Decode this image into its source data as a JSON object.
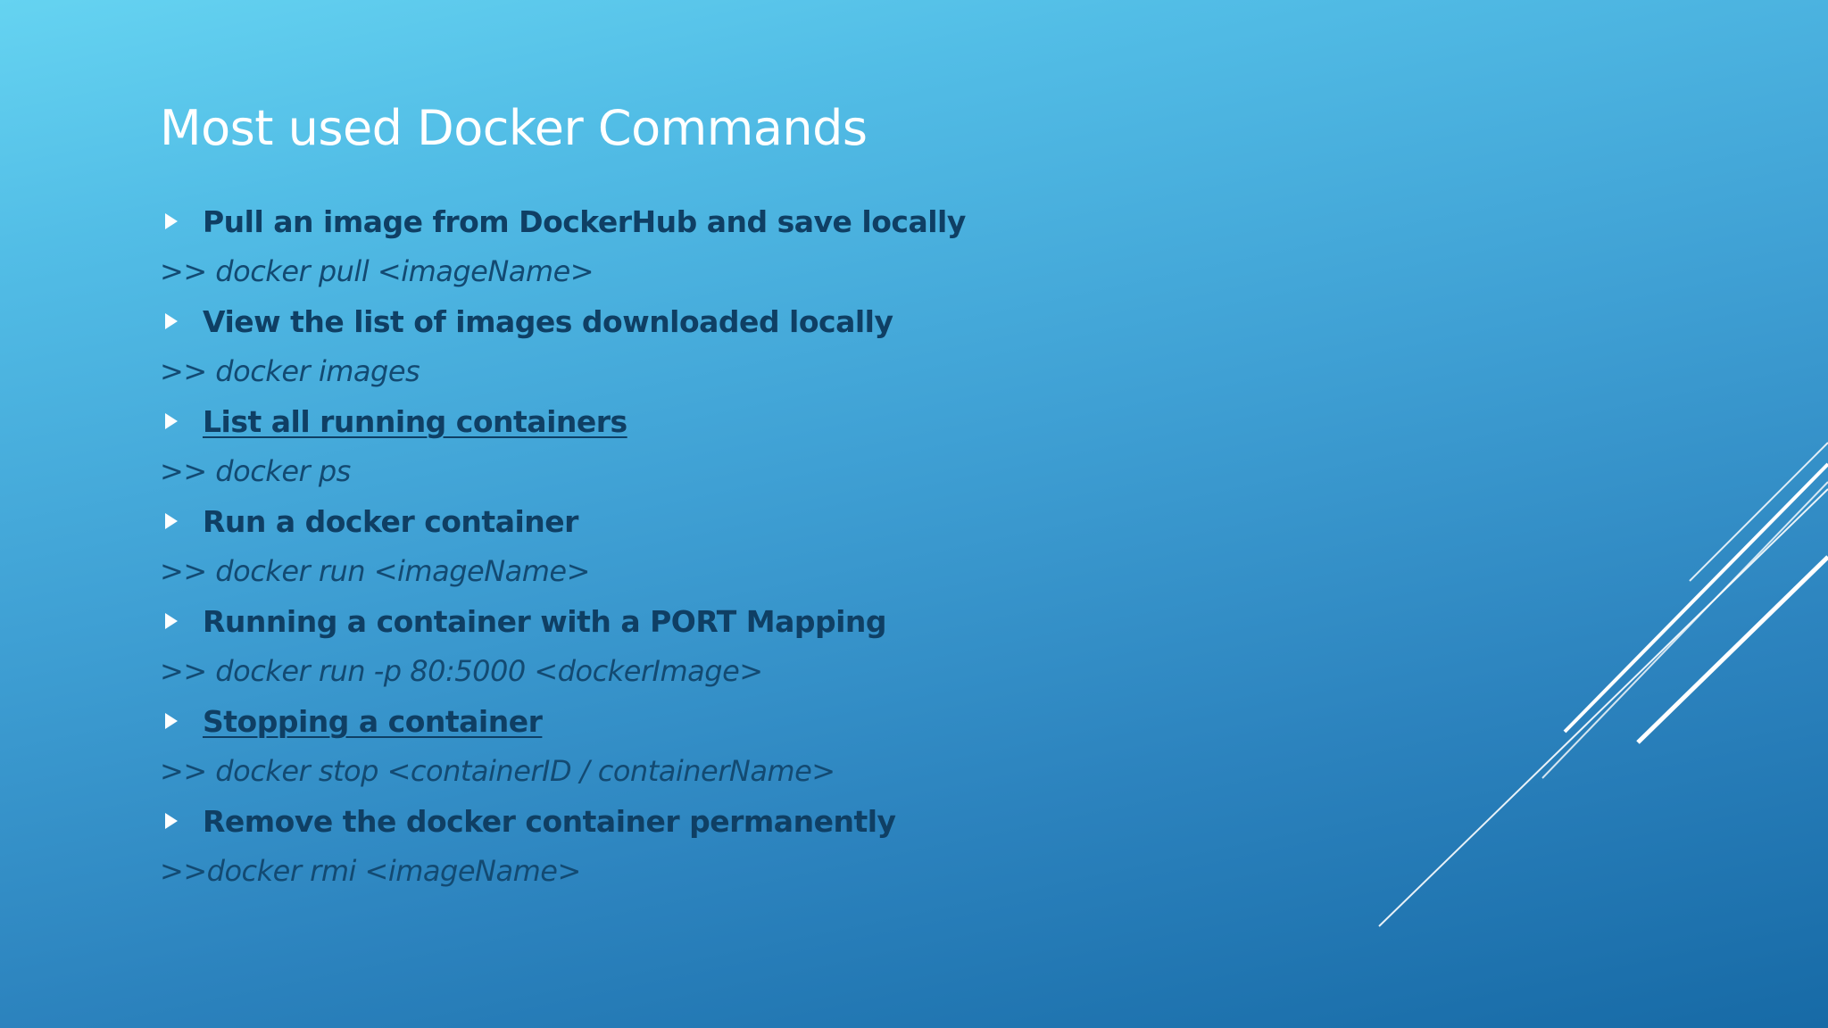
{
  "slide": {
    "title": "Most used Docker Commands",
    "items": [
      {
        "heading": "Pull an image from DockerHub and save locally",
        "command": ">> docker pull <imageName>",
        "underlined": false
      },
      {
        "heading": "View the list of images downloaded locally",
        "command": ">> docker images",
        "underlined": false
      },
      {
        "heading": "List all running containers",
        "command": ">> docker ps",
        "underlined": true
      },
      {
        "heading": "Run a docker container",
        "command": ">> docker run <imageName>",
        "underlined": false
      },
      {
        "heading": "Running a container with a PORT Mapping",
        "command": ">> docker run -p 80:5000 <dockerImage>",
        "underlined": false
      },
      {
        "heading": "Stopping a container",
        "command": ">> docker stop <containerID / containerName>",
        "underlined": true
      },
      {
        "heading": "Remove the docker container permanently",
        "command": ">>docker rmi <imageName>",
        "underlined": false
      }
    ]
  },
  "colors": {
    "title": "#ffffff",
    "heading": "#0f3f64",
    "command": "#134a72",
    "bullet": "#ffffff",
    "accent_lines": "#ffffff"
  },
  "icons": {
    "bullet": "triangle-right-icon"
  }
}
